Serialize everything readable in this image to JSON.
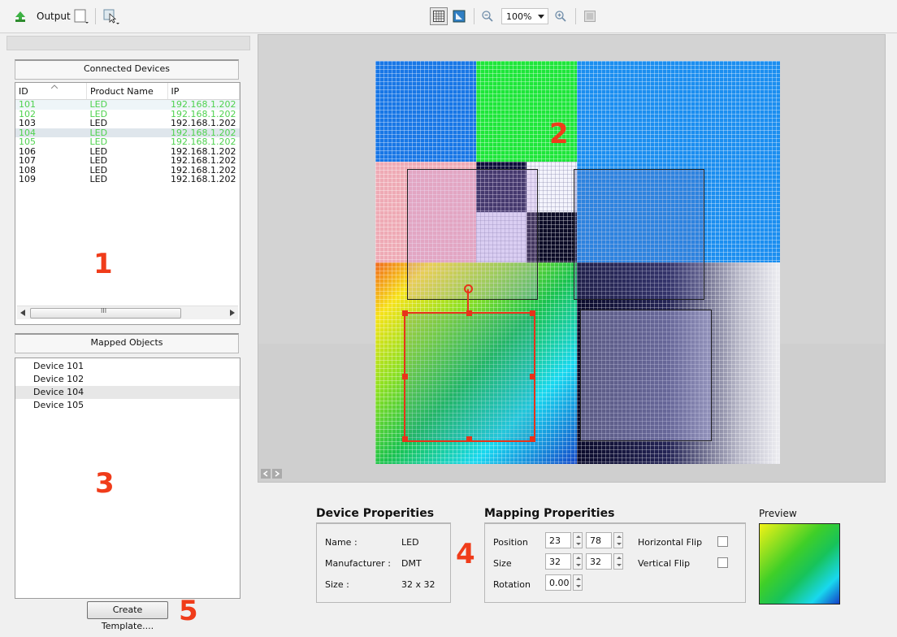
{
  "toolbar": {
    "output_label": "Output",
    "zoom_value": "100%"
  },
  "connected": {
    "header": "Connected Devices",
    "columns": [
      "ID",
      "Product Name",
      "IP"
    ],
    "rows": [
      {
        "id": "101",
        "name": "LED",
        "ip": "192.168.1.202"
      },
      {
        "id": "102",
        "name": "LED",
        "ip": "192.168.1.202"
      },
      {
        "id": "103",
        "name": "LED",
        "ip": "192.168.1.202"
      },
      {
        "id": "104",
        "name": "LED",
        "ip": "192.168.1.202"
      },
      {
        "id": "105",
        "name": "LED",
        "ip": "192.168.1.202"
      },
      {
        "id": "106",
        "name": "LED",
        "ip": "192.168.1.202"
      },
      {
        "id": "107",
        "name": "LED",
        "ip": "192.168.1.202"
      },
      {
        "id": "108",
        "name": "LED",
        "ip": "192.168.1.202"
      },
      {
        "id": "109",
        "name": "LED",
        "ip": "192.168.1.202"
      }
    ],
    "green_color": "#4fd24f",
    "scroll_grip": "III"
  },
  "mapped": {
    "header": "Mapped Objects",
    "items": [
      "Device 101",
      "Device 102",
      "Device 104",
      "Device 105"
    ]
  },
  "callouts": {
    "n1": "1",
    "n2": "2",
    "n3": "3",
    "n4": "4",
    "n5": "5"
  },
  "create_template_label": "Create Template....",
  "device_props": {
    "title": "Device Properities",
    "name_label": "Name :",
    "name_value": "LED",
    "manufacturer_label": "Manufacturer :",
    "manufacturer_value": "DMT",
    "size_label": "Size :",
    "size_value": "32 x 32"
  },
  "mapping_props": {
    "title": "Mapping Properities",
    "position_label": "Position",
    "position_x": "23",
    "position_y": "78",
    "size_label": "Size",
    "size_w": "32",
    "size_h": "32",
    "rotation_label": "Rotation",
    "rotation_value": "0.00",
    "hflip_label": "Horizontal Flip",
    "vflip_label": "Vertical Flip"
  },
  "preview_label": "Preview",
  "colors": {
    "accent": "#f03c1a",
    "selection": "#e8331a"
  }
}
